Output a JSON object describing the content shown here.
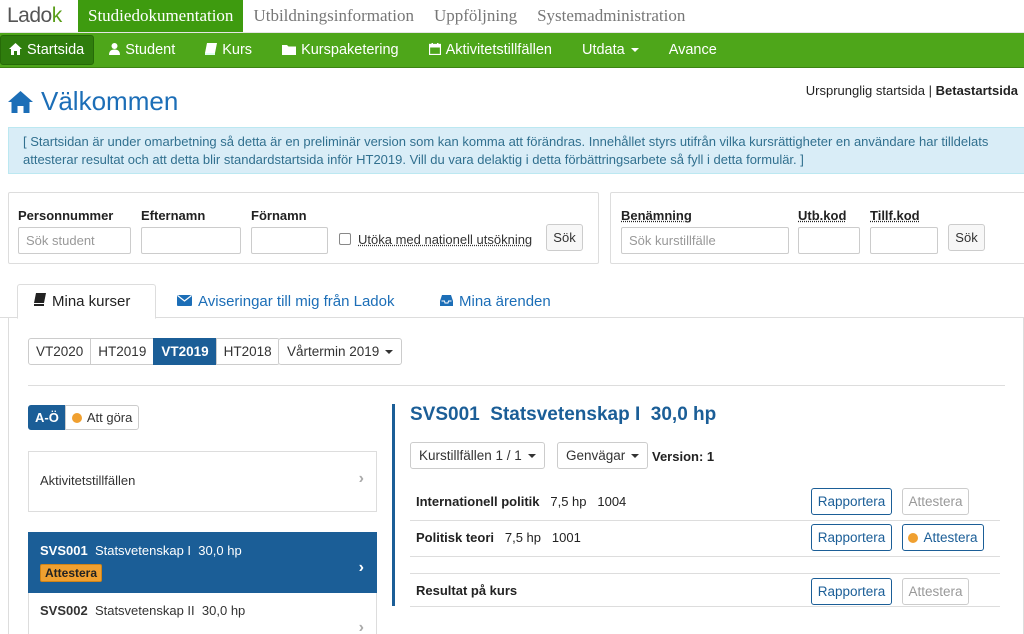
{
  "app": {
    "logo_prefix": "Ladok",
    "logo_suffix": "k"
  },
  "topnav": {
    "items": [
      {
        "label": "Studiedokumentation",
        "active": true
      },
      {
        "label": "Utbildningsinformation",
        "active": false
      },
      {
        "label": "Uppföljning",
        "active": false
      },
      {
        "label": "Systemadministration",
        "active": false
      }
    ]
  },
  "greennav": {
    "items": [
      {
        "label": "Startsida",
        "icon": "home-icon"
      },
      {
        "label": "Student",
        "icon": "user-icon"
      },
      {
        "label": "Kurs",
        "icon": "book-icon"
      },
      {
        "label": "Kurspaketering",
        "icon": "folder-icon"
      },
      {
        "label": "Aktivitetstillfällen",
        "icon": "calendar-icon"
      },
      {
        "label": "Utdata",
        "icon": ""
      },
      {
        "label": "Avance",
        "icon": ""
      }
    ]
  },
  "welcome": {
    "title": "Välkommen",
    "original_link": "Ursprunglig startsida",
    "separator": "|",
    "beta_link": "Betastartsida"
  },
  "alert": {
    "line1": "[ Startsidan är under omarbetning så detta är en preliminär version som kan komma att förändras. Innehållet styrs utifrån vilka kursrättigheter en användare har tilldelats",
    "line2": "attesterar resultat och att detta blir standardstartsida inför HT2019. Vill du vara delaktig i detta förbättringsarbete så fyll i detta formulär. ]"
  },
  "student_search": {
    "personnummer_label": "Personnummer",
    "personnummer_placeholder": "Sök student",
    "efternamn_label": "Efternamn",
    "fornamn_label": "Förnamn",
    "national_label": "Utöka med nationell utsökning",
    "search_button": "Sök"
  },
  "course_search": {
    "benamning_label": "Benämning",
    "benamning_placeholder": "Sök kurstillfälle",
    "utbkod_label": "Utb.kod",
    "tillfkod_label": "Tillf.kod",
    "search_button": "Sök"
  },
  "tabs": [
    {
      "label": "Mina kurser",
      "icon": "book-icon",
      "active": true
    },
    {
      "label": "Aviseringar till mig från Ladok",
      "icon": "envelope-icon",
      "active": false
    },
    {
      "label": "Mina ärenden",
      "icon": "inbox-icon",
      "active": false
    }
  ],
  "terms": {
    "items": [
      "VT2020",
      "HT2019",
      "VT2019",
      "HT2018"
    ],
    "active": "VT2019",
    "period_dropdown": "Vårtermin 2019"
  },
  "sort": {
    "alpha_label": "A-Ö",
    "todo_label": "Att göra"
  },
  "left_list": {
    "activities_label": "Aktivitetstillfällen",
    "courses": [
      {
        "code": "SVS001",
        "name": "Statsvetenskap I",
        "credits": "30,0 hp",
        "badge": "Attestera",
        "selected": true
      },
      {
        "code": "SVS002",
        "name": "Statsvetenskap II",
        "credits": "30,0 hp",
        "badge": "",
        "selected": false
      }
    ]
  },
  "course_detail": {
    "title": "SVS001  Statsvetenskap I  30,0 hp",
    "tillfallen_dropdown": "Kurstillfällen 1 / 1",
    "genvagar_dropdown": "Genvägar",
    "version": "Version: 1",
    "modules": [
      {
        "name": "Internationell politik",
        "credits": "7,5 hp",
        "code": "1004",
        "report": "Rapportera",
        "attest": "Attestera",
        "attest_active": false
      },
      {
        "name": "Politisk teori",
        "credits": "7,5 hp",
        "code": "1001",
        "report": "Rapportera",
        "attest": "Attestera",
        "attest_active": true
      }
    ],
    "result": {
      "name": "Resultat på kurs",
      "report": "Rapportera",
      "attest": "Attestera"
    }
  },
  "colors": {
    "brand_green": "#4ea61a",
    "active_green": "#3e9b0f",
    "primary_blue": "#1b5e97",
    "link_blue": "#1c6eb7",
    "badge_orange": "#f0a030"
  }
}
